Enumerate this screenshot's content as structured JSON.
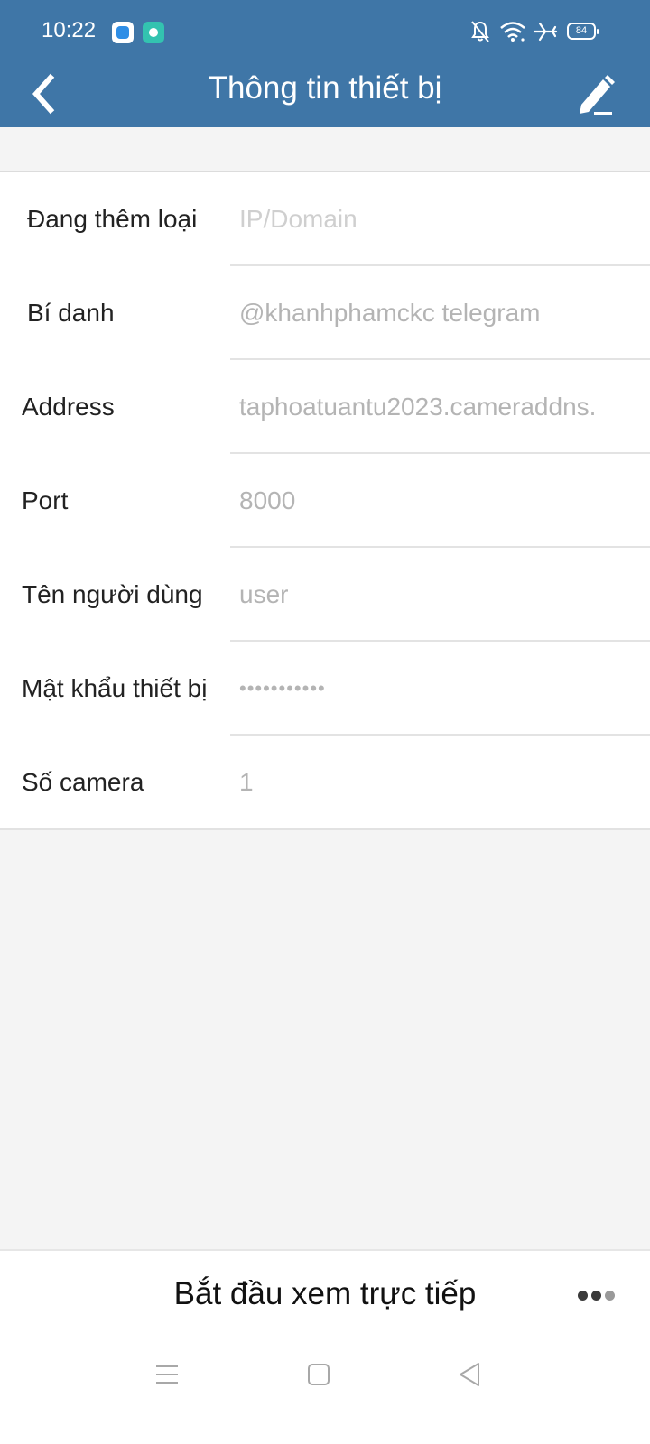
{
  "status_bar": {
    "time": "10:22",
    "battery": "84",
    "icons": [
      "app-icon-blue",
      "app-icon-teal",
      "bell-off-icon",
      "wifi-icon",
      "airplane-icon",
      "battery-icon"
    ]
  },
  "header": {
    "title": "Thông tin thiết bị",
    "back_icon": "chevron-left-icon",
    "edit_icon": "pencil-icon",
    "background": "#3f76a7"
  },
  "form": {
    "fields": [
      {
        "label": "Đang thêm loại",
        "value": "IP/Domain"
      },
      {
        "label": "Bí danh",
        "value": "@khanhphamckc telegram"
      },
      {
        "label": "Address",
        "value": "taphoatuantu2023.cameraddns."
      },
      {
        "label": "Port",
        "value": "8000"
      },
      {
        "label": "Tên người dùng",
        "value": "user"
      },
      {
        "label": "Mật khẩu thiết bị",
        "value": "•••••••••••"
      },
      {
        "label": "Số camera",
        "value": "1"
      }
    ]
  },
  "footer": {
    "start_label": "Bắt đầu xem trực tiếp",
    "more_icon": "more-dots-icon"
  },
  "system_nav": {
    "icons": [
      "menu-icon",
      "home-square-icon",
      "back-triangle-icon"
    ]
  }
}
